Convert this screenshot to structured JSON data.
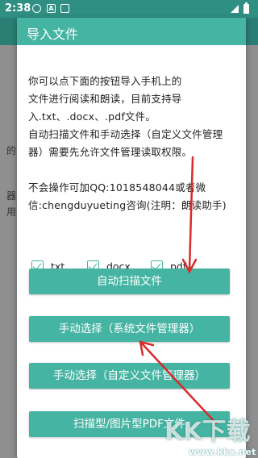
{
  "status_bar": {
    "time": "2:38",
    "icons": [
      "gear-icon",
      "a-notification-icon",
      "sd-card-icon",
      "signal-icon",
      "battery-icon"
    ]
  },
  "background_fragments": [
    "的",
    "器",
    "用"
  ],
  "dialog": {
    "title": "导入文件",
    "paragraph1": "你可以点下面的按钮导入手机上的\n文件进行阅读和朗读，目前支持导\n入.txt、.docx、.pdf文件。\n自动扫描文件和手动选择（自定义文件管理\n器）需要先允许文件管理读取权限。",
    "paragraph2": "不会操作可加QQ:1018548044或者微\n信:chengduyueting咨询(注明：朗读助手)",
    "checkboxes": [
      {
        "label": ".txt",
        "checked": true
      },
      {
        "label": ".docx",
        "checked": true
      },
      {
        "label": ".pdf",
        "checked": true
      }
    ],
    "buttons": {
      "auto_scan": "自动扫描文件",
      "manual_system": "手动选择（系统文件管理器）",
      "manual_custom": "手动选择（自定义文件管理器）",
      "scan_pdf": "扫描型/图片型PDF文件"
    }
  },
  "watermark": {
    "text": "www.kkx.net"
  },
  "colors": {
    "accent": "#45b4a2",
    "status_bar": "#2f8f82",
    "arrow": "#d92a2a"
  }
}
